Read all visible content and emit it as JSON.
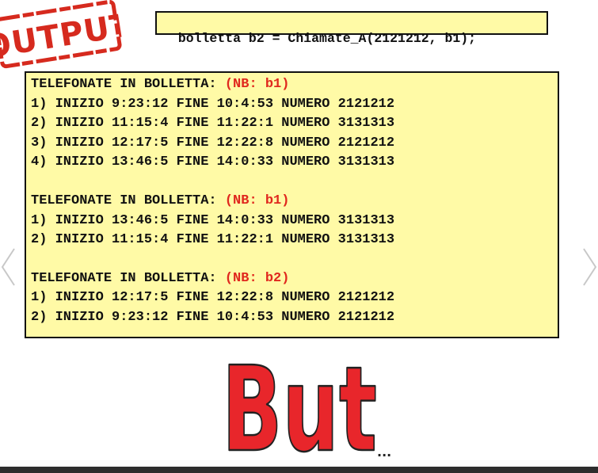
{
  "stamp": {
    "text": "OUTPUT",
    "color": "#d62a1e"
  },
  "code": {
    "statement": "bolletta b2 = Chiamate_A(2121212, b1);"
  },
  "output": {
    "blocks": [
      {
        "header": "TELEFONATE IN BOLLETTA:",
        "note": "(NB: b1)",
        "rows": [
          "1) INIZIO 9:23:12 FINE 10:4:53 NUMERO 2121212",
          "2) INIZIO 11:15:4 FINE 11:22:1 NUMERO 3131313",
          "3) INIZIO 12:17:5 FINE 12:22:8 NUMERO 2121212",
          "4) INIZIO 13:46:5 FINE 14:0:33 NUMERO 3131313"
        ]
      },
      {
        "header": "TELEFONATE IN BOLLETTA:",
        "note": "(NB: b1)",
        "rows": [
          "1) INIZIO 13:46:5 FINE 14:0:33 NUMERO 3131313",
          "2) INIZIO 11:15:4 FINE 11:22:1 NUMERO 3131313"
        ]
      },
      {
        "header": "TELEFONATE IN BOLLETTA:",
        "note": "(NB: b2)",
        "rows": [
          "1) INIZIO 12:17:5 FINE 12:22:8 NUMERO 2121212",
          "2) INIZIO 9:23:12 FINE 10:4:53 NUMERO 2121212"
        ]
      }
    ]
  },
  "art": {
    "text": "But",
    "trailing": "...",
    "color": "#e8262b"
  },
  "icons": {
    "prev": "chevron-left-icon",
    "next": "chevron-right-icon"
  }
}
